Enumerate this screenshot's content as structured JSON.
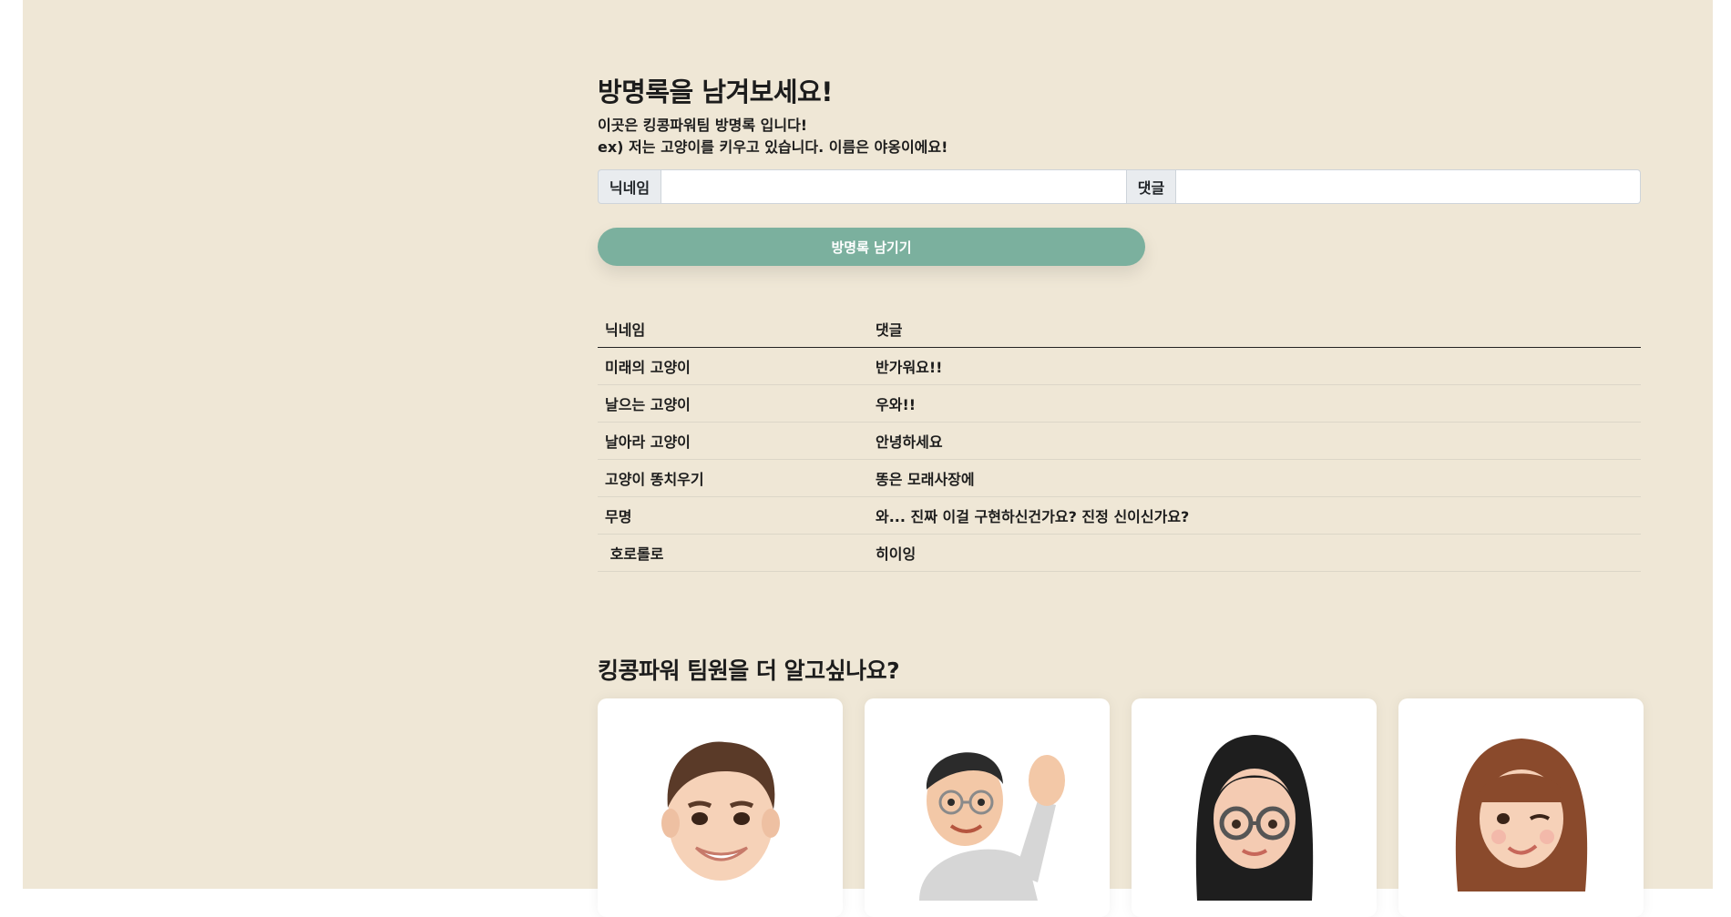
{
  "guestbook": {
    "title": "방명록을 남겨보세요!",
    "desc1": "이곳은 킹콩파워팀 방명록 입니다!",
    "desc2": "ex) 저는 고양이를 키우고 있습니다. 이름은 야옹이에요!",
    "nickname_label": "닉네임",
    "nickname_value": "",
    "comment_label": "댓글",
    "comment_value": "",
    "submit_label": "방명록 남기기"
  },
  "table": {
    "headers": [
      "닉네임",
      "댓글"
    ],
    "rows": [
      {
        "nickname": "미래의 고양이",
        "comment": "반가워요!!"
      },
      {
        "nickname": "날으는 고양이",
        "comment": "우와!!"
      },
      {
        "nickname": "날아라 고양이",
        "comment": "안녕하세요"
      },
      {
        "nickname": "고양이 똥치우기",
        "comment": "똥은 모래사장에"
      },
      {
        "nickname": "무명",
        "comment": "와... 진짜 이걸 구현하신건가요? 진정 신이신가요?"
      },
      {
        "nickname": " 호로롤로",
        "comment": "히이잉"
      }
    ]
  },
  "team": {
    "title": "킹콩파워 팀원을 더 알고싶나요?",
    "members": [
      {
        "avatar": "memoji-man-smiling-icon"
      },
      {
        "avatar": "memoji-boy-waving-icon"
      },
      {
        "avatar": "memoji-girl-glasses-icon"
      },
      {
        "avatar": "memoji-girl-winking-icon"
      }
    ]
  },
  "colors": {
    "page_bg": "#efe7d6",
    "button": "#7bb09e",
    "card": "#ffffff"
  }
}
